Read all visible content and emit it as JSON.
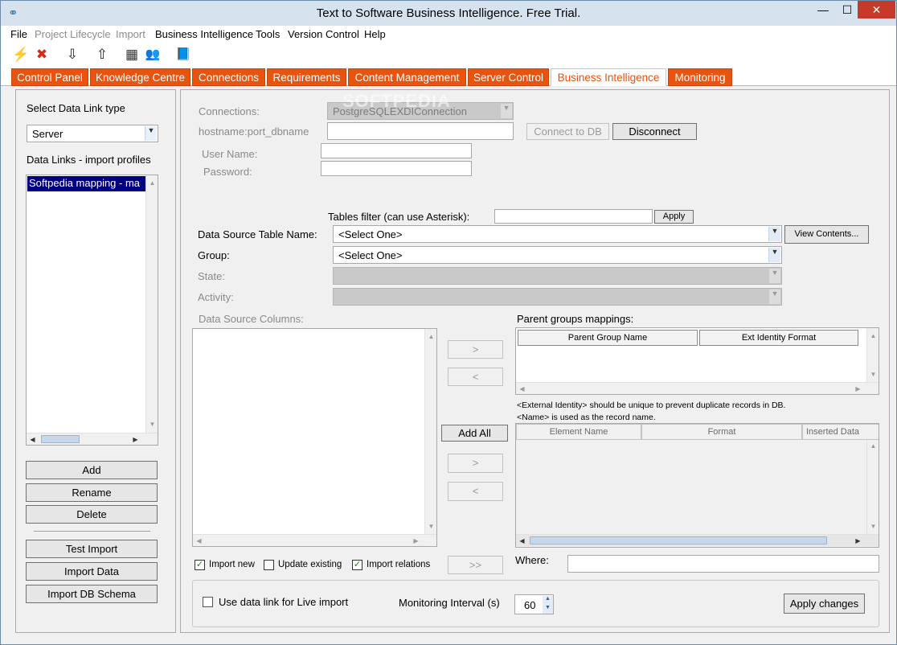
{
  "window": {
    "title": "Text to Software Business Intelligence. Free Trial.",
    "min_glyph": "—",
    "max_glyph": "☐",
    "close_glyph": "✕"
  },
  "menu": [
    {
      "label": "File",
      "enabled": true
    },
    {
      "label": "Project Lifecycle",
      "enabled": false
    },
    {
      "label": "Import",
      "enabled": false
    },
    {
      "label": "Business Intelligence",
      "enabled": true
    },
    {
      "label": "Tools",
      "enabled": true
    },
    {
      "label": "Version Control",
      "enabled": true
    },
    {
      "label": "Help",
      "enabled": true
    }
  ],
  "toolbar": {
    "icons": [
      {
        "name": "lightning-icon",
        "glyph": "⚡",
        "color": "#d4a800"
      },
      {
        "name": "delete-icon",
        "glyph": "✖",
        "color": "#d42a1a"
      },
      {
        "name": "arrow-down-icon",
        "glyph": "⇩",
        "color": "#222222"
      },
      {
        "name": "arrow-up-icon",
        "glyph": "⇧",
        "color": "#222222"
      },
      {
        "name": "form-icon",
        "glyph": "▦",
        "color": "#333333"
      },
      {
        "name": "users-icon",
        "glyph": "👥",
        "color": "#3355aa"
      },
      {
        "name": "book-icon",
        "glyph": "📘",
        "color": "#2255aa"
      }
    ]
  },
  "tabs": [
    {
      "label": "Control Panel",
      "active": false
    },
    {
      "label": "Knowledge Centre",
      "active": false
    },
    {
      "label": "Connections",
      "active": false
    },
    {
      "label": "Requirements",
      "active": false
    },
    {
      "label": "Content Management",
      "active": false
    },
    {
      "label": "Server Control",
      "active": false
    },
    {
      "label": "Business Intelligence",
      "active": true
    },
    {
      "label": "Monitoring",
      "active": false
    }
  ],
  "colors": {
    "tab_orange": "#e8540e",
    "selection_blue": "#000080",
    "check_green": "#1e7a1e"
  },
  "left": {
    "link_type_label": "Select Data Link type",
    "link_type_value": "Server",
    "profiles_label": "Data Links - import profiles",
    "profiles": [
      "Softpedia mapping - ma"
    ],
    "buttons": {
      "add": "Add",
      "rename": "Rename",
      "delete": "Delete",
      "test_import": "Test Import",
      "import_data": "Import Data",
      "import_schema": "Import DB Schema"
    }
  },
  "conn": {
    "connections_label": "Connections:",
    "connections_value": "PostgreSQLEXDIConnection",
    "host_label": "hostname:port_dbname",
    "host_value": "",
    "connect_label": "Connect to DB",
    "disconnect_label": "Disconnect",
    "user_label": "User Name:",
    "user_value": "",
    "password_label": "Password:",
    "password_value": ""
  },
  "filter": {
    "label": "Tables filter (can use Asterisk):",
    "value": "",
    "apply_label": "Apply"
  },
  "mapping": {
    "table_label": "Data Source Table Name:",
    "table_value": "<Select One>",
    "view_contents_label": "View Contents...",
    "group_label": "Group:",
    "group_value": "<Select One>",
    "state_label": "State:",
    "state_value": "",
    "activity_label": "Activity:",
    "activity_value": ""
  },
  "columns": {
    "label": "Data Source Columns:",
    "move_right": ">",
    "move_left": "<",
    "add_all": "Add All",
    "move_right2": ">",
    "move_left2": "<",
    "move_all": ">>"
  },
  "parents": {
    "label": "Parent groups mappings:",
    "headers": [
      "Parent Group Name",
      "Ext Identity Format"
    ],
    "note1": "<External Identity> should be unique to prevent duplicate records in DB.",
    "note2": "<Name> is used as the record name."
  },
  "elements": {
    "headers": [
      "Element Name",
      "Format",
      "Inserted Data"
    ]
  },
  "options": {
    "import_new": {
      "label": "Import new",
      "checked": true
    },
    "update_existing": {
      "label": "Update existing",
      "checked": false
    },
    "import_relations": {
      "label": "Import relations",
      "checked": true
    },
    "where_label": "Where:",
    "where_value": ""
  },
  "live": {
    "use_live_label": "Use data link for Live import",
    "use_live_checked": false,
    "interval_label": "Monitoring Interval (s)",
    "interval_value": "60",
    "apply_changes_label": "Apply changes"
  }
}
